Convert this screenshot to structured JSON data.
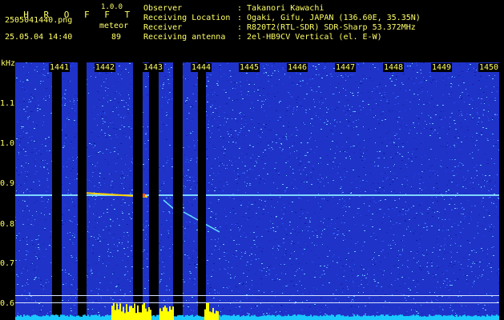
{
  "app": {
    "title": "H R O F F T",
    "version": "1.0.0"
  },
  "file": {
    "name": "2505041440.png",
    "datetime": "25.05.04 14:40"
  },
  "detection": {
    "label": "meteor",
    "count": "89"
  },
  "info": [
    {
      "key": "Observer",
      "value": ": Takanori Kawachi"
    },
    {
      "key": "Receiving Location",
      "value": ": Ogaki, Gifu, JAPAN (136.60E, 35.35N)"
    },
    {
      "key": "Receiver",
      "value": ": R820T2(RTL-SDR) SDR-Sharp 53.372MHz"
    },
    {
      "key": "Receiving antenna",
      "value": ": 2el-HB9CV Vertical (el. E-W)"
    }
  ],
  "axis": {
    "unit": "kHz",
    "freq_labels": [
      "1.1",
      "1.0",
      "0.9",
      "0.8",
      "0.7",
      "0.6"
    ],
    "minute_labels": [
      "1441",
      "1442",
      "1443",
      "1444",
      "1445",
      "1446",
      "1447",
      "1448",
      "1449",
      "1450"
    ]
  },
  "colors": {
    "text": "#ffff66",
    "background": "#000000",
    "noise": "#1a2fd6"
  }
}
